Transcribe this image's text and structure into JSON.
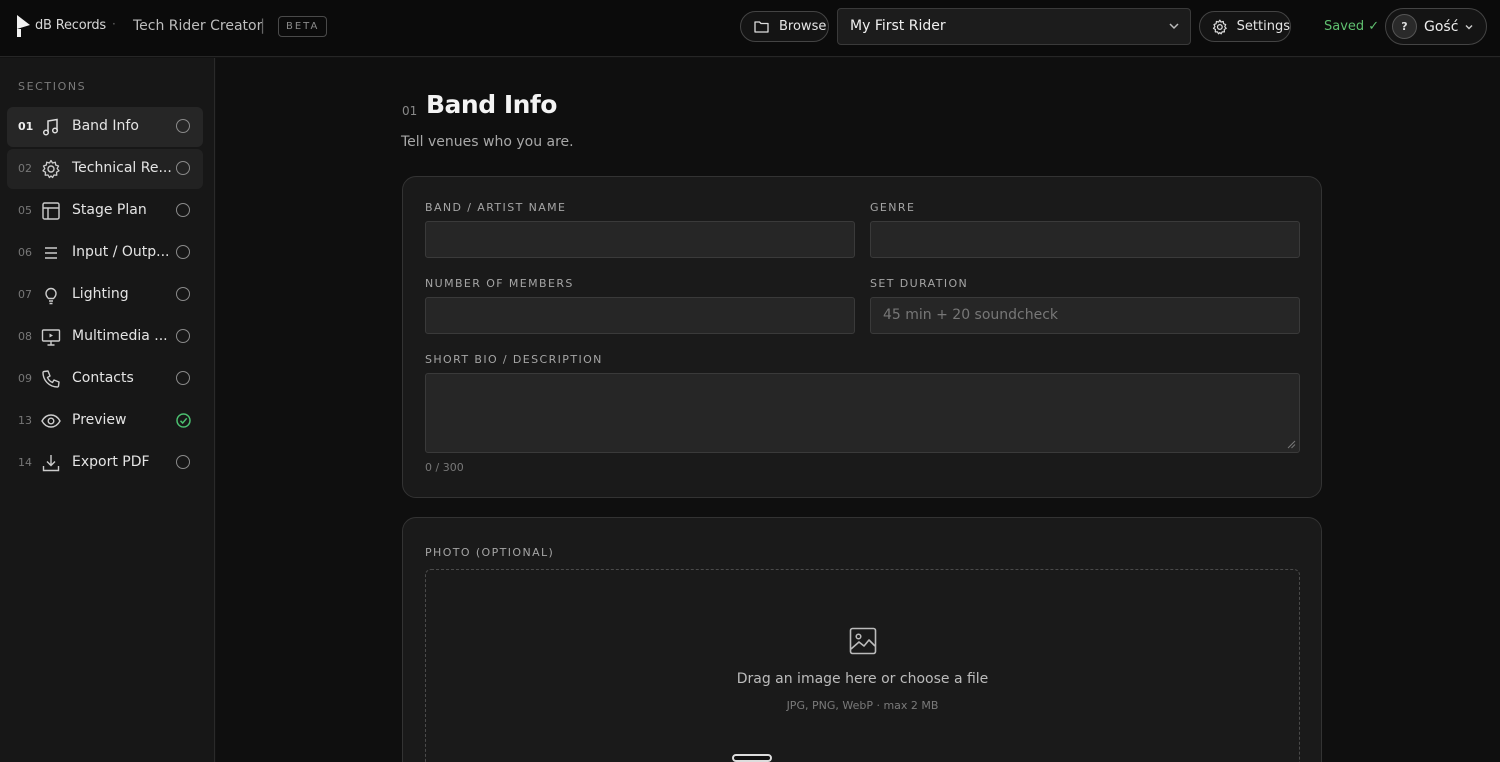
{
  "header": {
    "brand": "dB Records",
    "separator_dot": "·",
    "app_title": "Tech Rider Creator",
    "pipe": "|",
    "beta": "BETA",
    "browse_label": "Browse",
    "rider_name": "My First Rider",
    "settings_label": "Settings",
    "saved_status": "Saved ✓",
    "user_avatar": "?",
    "user_name": "Gość"
  },
  "sidebar": {
    "title": "SECTIONS",
    "items": [
      {
        "num": "01",
        "label": "Band Info",
        "icon": "music-note-icon",
        "status": "pending",
        "active": true
      },
      {
        "num": "02",
        "label": "Technical Re...",
        "icon": "gear-icon",
        "status": "pending"
      },
      {
        "num": "05",
        "label": "Stage Plan",
        "icon": "layout-grid-icon",
        "status": "pending"
      },
      {
        "num": "06",
        "label": "Input / Outp...",
        "icon": "list-icon",
        "status": "pending"
      },
      {
        "num": "07",
        "label": "Lighting",
        "icon": "lightbulb-icon",
        "status": "pending"
      },
      {
        "num": "08",
        "label": "Multimedia ...",
        "icon": "monitor-icon",
        "status": "pending"
      },
      {
        "num": "09",
        "label": "Contacts",
        "icon": "phone-icon",
        "status": "pending"
      },
      {
        "num": "13",
        "label": "Preview",
        "icon": "eye-icon",
        "status": "done"
      },
      {
        "num": "14",
        "label": "Export PDF",
        "icon": "download-icon",
        "status": "pending"
      }
    ]
  },
  "main": {
    "section_num": "01",
    "section_title": "Band Info",
    "section_subtitle": "Tell venues who you are.",
    "fields": {
      "band_name_label": "BAND / ARTIST NAME",
      "band_name_value": "",
      "genre_label": "GENRE",
      "genre_value": "",
      "members_label": "NUMBER OF MEMBERS",
      "members_value": "",
      "duration_label": "SET DURATION",
      "duration_placeholder": "45 min + 20 soundcheck",
      "bio_label": "SHORT BIO / DESCRIPTION",
      "bio_counter": "0 / 300"
    },
    "photo": {
      "label": "PHOTO (OPTIONAL)",
      "drop_text": "Drag an image here or choose a file",
      "hint": "JPG, PNG, WebP · max 2 MB"
    }
  },
  "colors": {
    "accent_green": "#5fbf6f",
    "background": "#0f0f0f",
    "card": "#1a1a1a"
  }
}
